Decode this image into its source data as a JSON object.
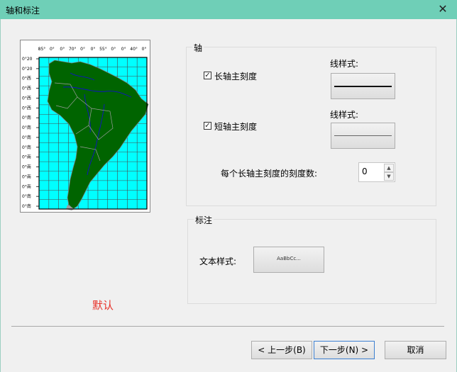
{
  "window": {
    "title": "轴和标注",
    "close_glyph": "✕"
  },
  "preview": {
    "top_ticks": [
      "85°",
      "0°",
      "0°",
      "70°",
      "0°",
      "0°",
      "55°",
      "0°",
      "0°",
      "40°",
      "0°"
    ],
    "left_ticks": [
      "0°20",
      "0°20",
      "0°西",
      "0°西",
      "0°西",
      "0°西",
      "0°南",
      "0°南",
      "0°南",
      "0°南",
      "0°南",
      "0°南",
      "0°南",
      "0°南",
      "0°南",
      "0°南"
    ],
    "colors": {
      "ocean": "#00ffff",
      "land": "#006400",
      "grid": "#7dbd7d",
      "rivers": "#1010c8",
      "borders": "#9e9e9e"
    }
  },
  "axis_group": {
    "title": "轴",
    "major_tick": {
      "checked": true,
      "label": "长轴主刻度"
    },
    "major_line_style_label": "线样式:",
    "minor_tick": {
      "checked": true,
      "label": "短轴主刻度"
    },
    "minor_line_style_label": "线样式:",
    "minor_per_major_label": "每个长轴主刻度的刻度数:",
    "minor_per_major_value": "0",
    "spin_up": "▲",
    "spin_down": "▼"
  },
  "label_group": {
    "title": "标注",
    "text_style_label": "文本样式:",
    "text_style_sample": "AaBbCc..."
  },
  "default_label": "默认",
  "buttons": {
    "back": "< 上一步(B)",
    "next": "下一步(N) >",
    "cancel": "取消"
  },
  "checkmark": "✓"
}
